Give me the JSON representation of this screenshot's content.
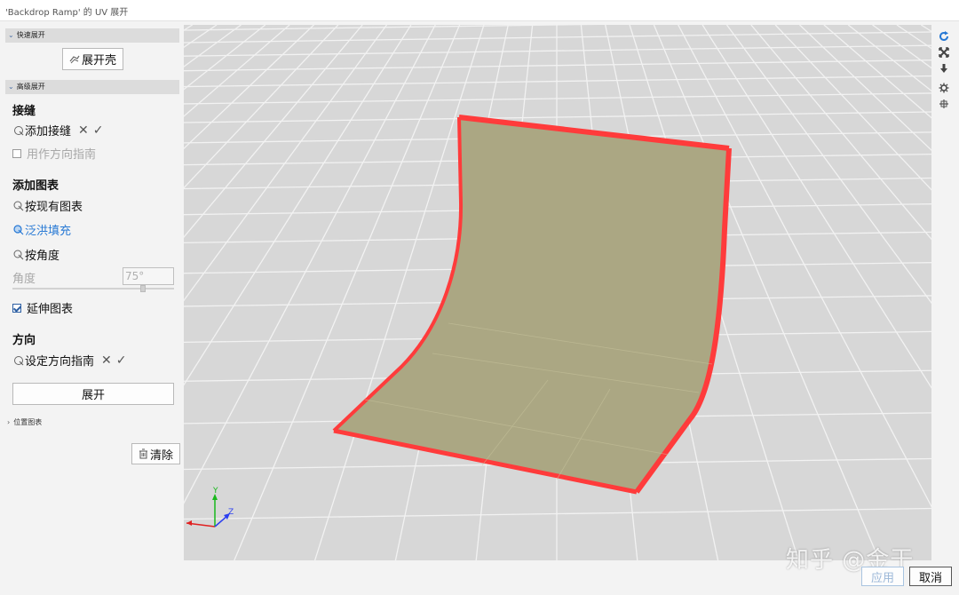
{
  "window": {
    "title": "'Backdrop Ramp' 的 UV 展开"
  },
  "quick": {
    "header": "快速展开",
    "shell_button": "展开壳"
  },
  "advanced": {
    "header": "高级展开",
    "seams": {
      "title": "接缝",
      "add_seam": "添加接缝",
      "use_as_guide": "用作方向指南",
      "use_as_guide_checked": false
    },
    "add_chart": {
      "title": "添加图表",
      "by_existing": "按现有图表",
      "flood_fill": "泛洪填充",
      "by_angle": "按角度",
      "angle_label": "角度",
      "angle_value": "75°",
      "extend_chart": "延伸图表",
      "extend_chart_checked": true
    },
    "direction": {
      "title": "方向",
      "set_guide": "设定方向指南"
    },
    "unwrap_button": "展开"
  },
  "position_chart": {
    "header": "位置图表"
  },
  "clear_button": "清除",
  "marks": {
    "cancel": "✕",
    "confirm": "✓"
  },
  "axes": {
    "y": "Y",
    "z": "Z"
  },
  "footer": {
    "apply": "应用",
    "cancel": "取消"
  },
  "watermark": "知乎 @金干",
  "colors": {
    "accent": "#2678d4",
    "surface": "#aba783",
    "edge": "#ff3b3b",
    "grid_bg": "#d7d7d7",
    "grid_line": "#f2f2f2"
  },
  "icons": [
    "refresh-icon",
    "expand-arrows-icon",
    "download-arrow-icon",
    "gear-icon",
    "move-icon",
    "chevron-down-icon",
    "chevron-right-icon",
    "pick-cursor-icon",
    "trash-icon",
    "shell-unwrap-icon"
  ]
}
